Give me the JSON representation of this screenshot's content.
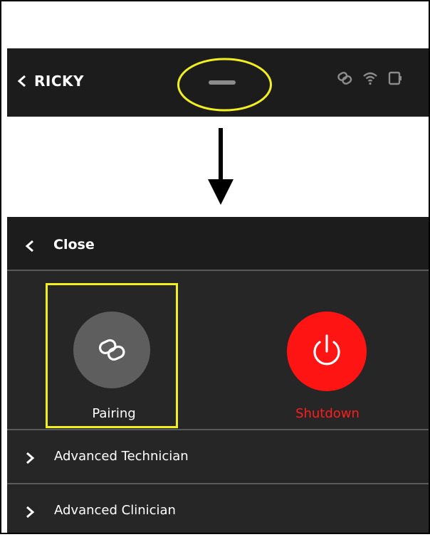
{
  "header": {
    "device_name": "RICKY"
  },
  "menu": {
    "close_label": "Close",
    "quick_actions": [
      {
        "label": "Pairing",
        "icon": "link-icon",
        "color": "#5e5e5e"
      },
      {
        "label": "Shutdown",
        "icon": "power-icon",
        "color": "#ff1414"
      }
    ],
    "sections": [
      {
        "label": "Advanced Technician"
      },
      {
        "label": "Advanced Clinician"
      }
    ]
  },
  "colors": {
    "highlight": "#f2ef1e",
    "shutdown_text": "#ff1d1d",
    "bar_background": "#1c1c1c",
    "panel_background": "#262626"
  }
}
